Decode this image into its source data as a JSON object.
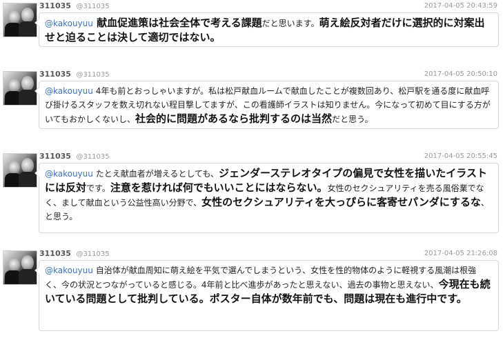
{
  "tweets": [
    {
      "name": "311035",
      "handle": "@311035",
      "date": "2017-04-05 20:43:59",
      "mention": "@kakouyuu",
      "segments": [
        {
          "text": " 献血促進策は社会全体で考える課題",
          "big": true
        },
        {
          "text": "だと思います。",
          "big": false
        },
        {
          "text": "萌え絵反対者だけに選択的に対案出せと迫ることは決して適切ではない。",
          "big": true
        }
      ]
    },
    {
      "name": "311035",
      "handle": "@311035",
      "date": "2017-04-05 20:50:10",
      "mention": "@kakouyuu",
      "segments": [
        {
          "text": " 4年も前とおっしゃいますが。私は松戸献血ルームで献血したことが複数回あり、松戸駅を通る度に献血呼び掛けるスタッフを数え切れない程目撃してますが、この看護師イラストは知りません。今になって初めて目にする方がいてもおかしくないし、",
          "big": false
        },
        {
          "text": "社会的に問題があるなら批判するのは当然",
          "big": true
        },
        {
          "text": "だと思う。",
          "big": false
        }
      ]
    },
    {
      "name": "311035",
      "handle": "@311035",
      "date": "2017-04-05 20:55:45",
      "mention": "@kakouyuu",
      "segments": [
        {
          "text": " たとえ献血者が増えるとしても、",
          "big": false
        },
        {
          "text": "ジェンダーステレオタイプの偏見で女性を描いたイラストには反対",
          "big": true
        },
        {
          "text": "です。",
          "big": false
        },
        {
          "text": "注意を惹ければ何でもいいことにはならない。",
          "big": true
        },
        {
          "text": "女性のセクシュアリティを売る風俗業でなく、まして献血という公益性高い分野で、",
          "big": false
        },
        {
          "text": "女性のセクシュアリティを大っぴらに客寄せパンダにするな",
          "big": true
        },
        {
          "text": "、と思う。",
          "big": false
        }
      ]
    },
    {
      "name": "311035",
      "handle": "@311035",
      "date": "2017-04-05 21:26:08",
      "mention": "@kakouyuu",
      "segments": [
        {
          "text": " 自治体が献血周知に萌え絵を平気で選んでしまうという、女性を性的物体のように軽視する風潮は根強く、今の状況とつながっていると感じる。4年前と比べ進歩があったと思えない、過去の事物と思えない、",
          "big": false
        },
        {
          "text": "今現在も続いている問題として批判している。ポスター自体が数年前でも、問題は現在も進行中です。",
          "big": true
        }
      ]
    }
  ]
}
